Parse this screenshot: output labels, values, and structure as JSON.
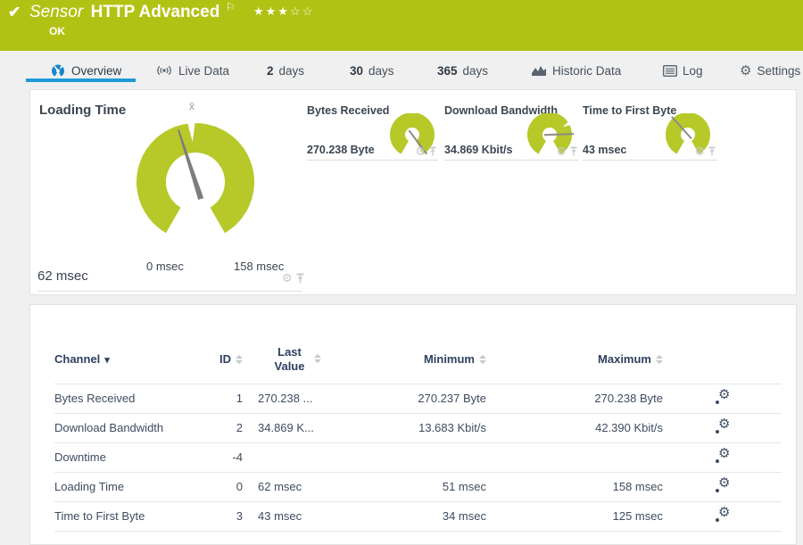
{
  "header": {
    "kind": "Sensor",
    "title": "HTTP Advanced",
    "status": "OK",
    "stars": "★★★☆☆",
    "stars_filled": 3,
    "stars_total": 5
  },
  "icons": {
    "check": "✔",
    "flag": "⚐",
    "gear": "⚙",
    "caret": "▾"
  },
  "tabs": {
    "overview": {
      "label": "Overview"
    },
    "live_data": {
      "label": "Live Data"
    },
    "d2": {
      "num": "2",
      "unit": "days"
    },
    "d30": {
      "num": "30",
      "unit": "days"
    },
    "d365": {
      "num": "365",
      "unit": "days"
    },
    "historic": {
      "label": "Historic Data"
    },
    "log": {
      "label": "Log"
    },
    "settings": {
      "label": "Settings"
    }
  },
  "gauges": {
    "primary": {
      "label": "Loading Time",
      "value": "62 msec",
      "value_num": 62,
      "min_label": "0 msec",
      "max_label": "158 msec",
      "min_num": 0,
      "max_num": 158,
      "unit": "msec",
      "mean_symbol": "x̄"
    },
    "small": [
      {
        "label": "Bytes Received",
        "value": "270.238 Byte"
      },
      {
        "label": "Download Bandwidth",
        "value": "34.869 Kbit/s"
      },
      {
        "label": "Time to First Byte",
        "value": "43 msec"
      }
    ]
  },
  "table": {
    "columns": {
      "channel": "Channel",
      "id": "ID",
      "last_value": "Last Value",
      "minimum": "Minimum",
      "maximum": "Maximum"
    },
    "rows": [
      {
        "channel": "Bytes Received",
        "id": "1",
        "last": "270.238 ...",
        "min": "270.237 Byte",
        "max": "270.238 Byte"
      },
      {
        "channel": "Download Bandwidth",
        "id": "2",
        "last": "34.869 K...",
        "min": "13.683 Kbit/s",
        "max": "42.390 Kbit/s"
      },
      {
        "channel": "Downtime",
        "id": "-4",
        "last": "",
        "min": "",
        "max": ""
      },
      {
        "channel": "Loading Time",
        "id": "0",
        "last": "62 msec",
        "min": "51 msec",
        "max": "158 msec"
      },
      {
        "channel": "Time to First Byte",
        "id": "3",
        "last": "43 msec",
        "min": "34 msec",
        "max": "125 msec"
      }
    ]
  },
  "colors": {
    "brand_green": "#b2c214",
    "gauge_green": "#b6c929",
    "accent_blue": "#1e9ad6",
    "header_text": "#2e4161"
  }
}
